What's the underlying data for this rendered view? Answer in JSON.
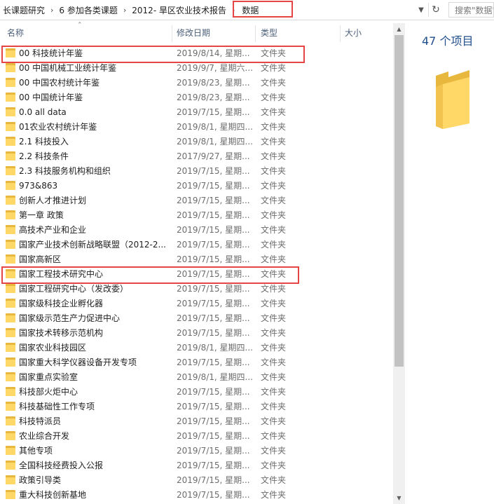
{
  "breadcrumb": {
    "items": [
      "长课题研究",
      "6 参加各类课题",
      "2012- 旱区农业技术报告",
      "数据"
    ],
    "separator": "›"
  },
  "address": {
    "dropdown_icon": "chevron-down-icon",
    "refresh_icon": "refresh-icon"
  },
  "search": {
    "placeholder": "搜索\"数据\""
  },
  "columns": {
    "name": "名称",
    "date": "修改日期",
    "type": "类型",
    "size": "大小"
  },
  "files": [
    {
      "name": "00 科技统计年鉴",
      "date": "2019/8/14, 星期...",
      "type": "文件夹"
    },
    {
      "name": "00 中国机械工业统计年鉴",
      "date": "2019/9/7, 星期六...",
      "type": "文件夹"
    },
    {
      "name": "00 中国农村统计年鉴",
      "date": "2019/8/23, 星期...",
      "type": "文件夹"
    },
    {
      "name": "00 中国统计年鉴",
      "date": "2019/8/23, 星期...",
      "type": "文件夹"
    },
    {
      "name": "0.0 all data",
      "date": "2019/7/15, 星期...",
      "type": "文件夹"
    },
    {
      "name": "01农业农村统计年鉴",
      "date": "2019/8/1, 星期四...",
      "type": "文件夹"
    },
    {
      "name": "2.1 科技投入",
      "date": "2019/8/1, 星期四...",
      "type": "文件夹"
    },
    {
      "name": "2.2 科技条件",
      "date": "2017/9/27, 星期...",
      "type": "文件夹"
    },
    {
      "name": "2.3 科技服务机构和组织",
      "date": "2019/7/15, 星期...",
      "type": "文件夹"
    },
    {
      "name": "973&863",
      "date": "2019/7/15, 星期...",
      "type": "文件夹"
    },
    {
      "name": "创新人才推进计划",
      "date": "2019/7/15, 星期...",
      "type": "文件夹"
    },
    {
      "name": "第一章 政策",
      "date": "2019/7/15, 星期...",
      "type": "文件夹"
    },
    {
      "name": "高技术产业和企业",
      "date": "2019/7/15, 星期...",
      "type": "文件夹"
    },
    {
      "name": "国家产业技术创新战略联盟（2012-2...",
      "date": "2019/7/15, 星期...",
      "type": "文件夹"
    },
    {
      "name": "国家高新区",
      "date": "2019/7/15, 星期...",
      "type": "文件夹"
    },
    {
      "name": "国家工程技术研究中心",
      "date": "2019/7/15, 星期...",
      "type": "文件夹"
    },
    {
      "name": "国家工程研究中心（发改委）",
      "date": "2019/7/15, 星期...",
      "type": "文件夹"
    },
    {
      "name": "国家级科技企业孵化器",
      "date": "2019/7/15, 星期...",
      "type": "文件夹"
    },
    {
      "name": "国家级示范生产力促进中心",
      "date": "2019/7/15, 星期...",
      "type": "文件夹"
    },
    {
      "name": "国家技术转移示范机构",
      "date": "2019/7/15, 星期...",
      "type": "文件夹"
    },
    {
      "name": "国家农业科技园区",
      "date": "2019/8/1, 星期四...",
      "type": "文件夹"
    },
    {
      "name": "国家重大科学仪器设备开发专项",
      "date": "2019/7/15, 星期...",
      "type": "文件夹"
    },
    {
      "name": "国家重点实验室",
      "date": "2019/8/1, 星期四...",
      "type": "文件夹"
    },
    {
      "name": "科技部火炬中心",
      "date": "2019/7/15, 星期...",
      "type": "文件夹"
    },
    {
      "name": "科技基础性工作专项",
      "date": "2019/7/15, 星期...",
      "type": "文件夹"
    },
    {
      "name": "科技特派员",
      "date": "2019/7/15, 星期...",
      "type": "文件夹"
    },
    {
      "name": "农业综合开发",
      "date": "2019/7/15, 星期...",
      "type": "文件夹"
    },
    {
      "name": "其他专项",
      "date": "2019/7/15, 星期...",
      "type": "文件夹"
    },
    {
      "name": "全国科技经费投入公报",
      "date": "2019/7/15, 星期...",
      "type": "文件夹"
    },
    {
      "name": "政策引导类",
      "date": "2019/7/15, 星期...",
      "type": "文件夹"
    },
    {
      "name": "重大科技创新基地",
      "date": "2019/7/15, 星期...",
      "type": "文件夹"
    }
  ],
  "details": {
    "count": "47 个项目"
  },
  "colors": {
    "highlight": "#e64545",
    "folder": "#ffd867",
    "header_text": "#4c607a",
    "count_text": "#1f4e8c"
  }
}
